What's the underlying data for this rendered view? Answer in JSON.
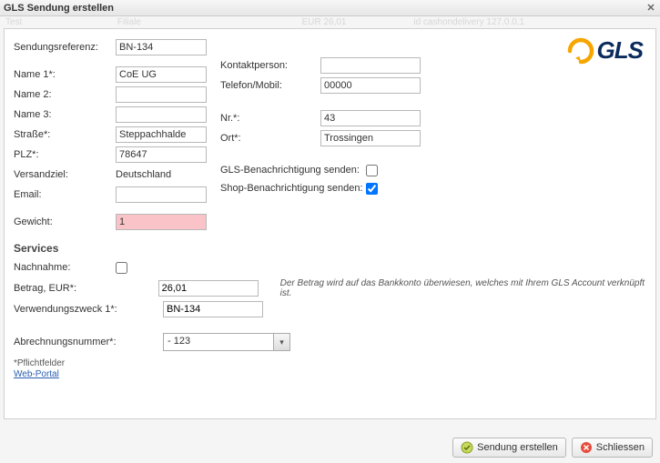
{
  "title": "GLS Sendung erstellen",
  "ghost": {
    "a": "Test",
    "b": "Filiale",
    "c": "EUR 26,01",
    "d": "id cashondelivery   127.0.0.1"
  },
  "logo_text": "GLS",
  "left": {
    "sendref_label": "Sendungsreferenz:",
    "sendref_value": "BN-134",
    "name1_label": "Name 1*:",
    "name1_value": "CoE UG",
    "name2_label": "Name 2:",
    "name2_value": "",
    "name3_label": "Name 3:",
    "name3_value": "",
    "street_label": "Straße*:",
    "street_value": "Steppachhalde",
    "plz_label": "PLZ*:",
    "plz_value": "78647",
    "versand_label": "Versandziel:",
    "versand_value": "Deutschland",
    "email_label": "Email:",
    "email_value": "",
    "weight_label": "Gewicht:",
    "weight_value": "1"
  },
  "right": {
    "contact_label": "Kontaktperson:",
    "contact_value": "",
    "phone_label": "Telefon/Mobil:",
    "phone_value": "00000",
    "nr_label": "Nr.*:",
    "nr_value": "43",
    "ort_label": "Ort*:",
    "ort_value": "Trossingen",
    "gls_notify_label": "GLS-Benachrichtigung senden:",
    "shop_notify_label": "Shop-Benachrichtigung senden:"
  },
  "services": {
    "heading": "Services",
    "nachnahme_label": "Nachnahme:",
    "betrag_label": "Betrag, EUR*:",
    "betrag_value": "26,01",
    "verwend_label": "Verwendungszweck 1*:",
    "verwend_value": "BN-134",
    "note": "Der Betrag wird auf das Bankkonto überwiesen, welches mit Ihrem GLS Account verknüpft ist.",
    "abrech_label": "Abrechnungsnummer*:",
    "abrech_value": " - 123"
  },
  "foot": {
    "pflicht": "*Pflichtfelder",
    "portal": "Web-Portal"
  },
  "buttons": {
    "create": "Sendung erstellen",
    "close": "Schliessen"
  }
}
